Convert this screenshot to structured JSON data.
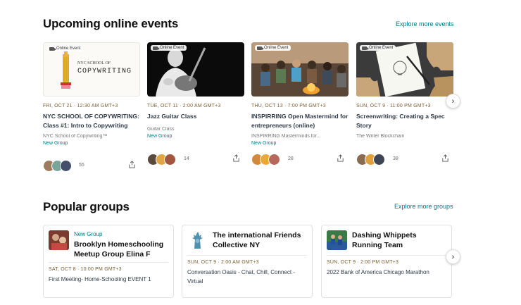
{
  "upcoming": {
    "title": "Upcoming online events",
    "explore": "Explore more events",
    "events": [
      {
        "badge": "Online Event",
        "date": "FRI, OCT 21 · 12:30 AM GMT+3",
        "title": "NYC SCHOOL OF COPYWRITING: Class #1: Intro to Copywriting",
        "group": "NYC School of Copywriting™",
        "new_group": "New Group",
        "attendees": "55",
        "image_text": {
          "line1": "NYC SCHOOL OF",
          "line2": "COPYWRITING"
        }
      },
      {
        "badge": "Online Event",
        "date": "TUE, OCT 11 · 2:00 AM GMT+3",
        "title": "Jazz Guitar Class",
        "group": "Guitar Class",
        "new_group": "New Group",
        "attendees": "14"
      },
      {
        "badge": "Online Event",
        "date": "THU, OCT 13 · 7:00 PM GMT+3",
        "title": "INSPIRRING Open Mastermind for entrepreneurs (online)",
        "group": "INSPIRRING Masterminds for...",
        "new_group": "New Group",
        "attendees": "28"
      },
      {
        "badge": "Online Event",
        "date": "SUN, OCT 9 · 11:00 PM GMT+3",
        "title": "Screenwriting: Creating a Spec Story",
        "group": "The Writer Blockchain",
        "attendees": "38"
      }
    ],
    "next_glyph": "›"
  },
  "popular": {
    "title": "Popular groups",
    "explore": "Explore more groups",
    "groups": [
      {
        "new_group": "New Group",
        "name": "Brooklyn Homeschooling Meetup Group Elina F",
        "date": "SAT, OCT 8 · 10:00 PM GMT+3",
        "event": "First Meeting- Home-Schooling EVENT 1"
      },
      {
        "name": "The international Friends Collective NY",
        "date": "SUN, OCT 9 · 2:00 AM GMT+3",
        "event": "Conversation Oasis - Chat, Chill, Connect - Virtual"
      },
      {
        "name": "Dashing Whippets Running Team",
        "date": "SUN, OCT 9 · 2:00 PM GMT+3",
        "event": "2022 Bank of America Chicago Marathon"
      }
    ],
    "next_glyph": "›"
  },
  "colors": {
    "accent": "#00798a",
    "date": "#7a5c30"
  }
}
